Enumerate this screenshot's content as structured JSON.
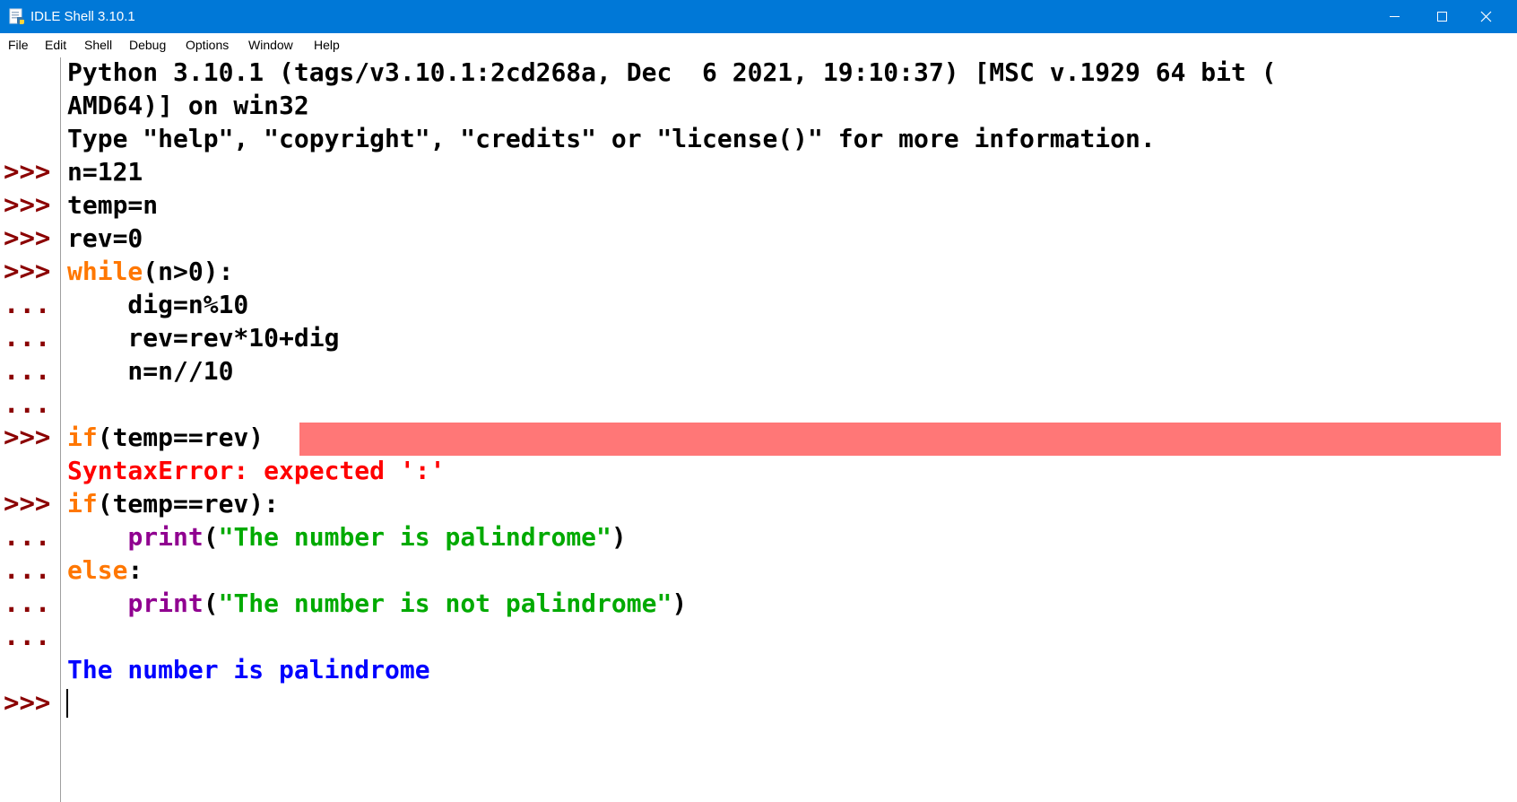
{
  "window": {
    "title": "IDLE Shell 3.10.1",
    "accent_color": "#0078d7",
    "icon": "python-idle-icon"
  },
  "menu": [
    "File",
    "Edit",
    "Shell",
    "Debug",
    "Options",
    "Window",
    "Help"
  ],
  "colors": {
    "prompt": "#8b0000",
    "keyword": "#ff7700",
    "builtin": "#900090",
    "string": "#00aa00",
    "error": "#ff0000",
    "output": "#0000ff",
    "error_highlight": "#ff7777"
  },
  "shell": {
    "banner_line1": "Python 3.10.1 (tags/v3.10.1:2cd268a, Dec  6 2021, 19:10:37) [MSC v.1929 64 bit (",
    "banner_line2": "AMD64)] on win32",
    "banner_line3": "Type \"help\", \"copyright\", \"credits\" or \"license()\" for more information.",
    "prompts": [
      ">>>",
      ">>>",
      ">>>",
      ">>>",
      "...",
      "...",
      "...",
      "...",
      ">>>",
      ">>>",
      "...",
      "...",
      "...",
      "...",
      ">>>"
    ],
    "code": {
      "l1": "n=121",
      "l2": "temp=n",
      "l3": "rev=0",
      "l4_kw": "while",
      "l4_rest": "(n>0):",
      "l5": "    dig=n%10",
      "l6": "    rev=rev*10+dig",
      "l7": "    n=n//10",
      "l9_kw": "if",
      "l9_rest": "(temp==rev)",
      "error_msg": "SyntaxError: expected ':'",
      "l11_kw": "if",
      "l11_rest": "(temp==rev):",
      "l12_indent": "    ",
      "l12_fn": "print",
      "l12_open": "(",
      "l12_str": "\"The number is palindrome\"",
      "l12_close": ")",
      "l13_kw": "else",
      "l13_rest": ":",
      "l14_indent": "    ",
      "l14_fn": "print",
      "l14_open": "(",
      "l14_str": "\"The number is not palindrome\"",
      "l14_close": ")",
      "output": "The number is palindrome"
    }
  }
}
